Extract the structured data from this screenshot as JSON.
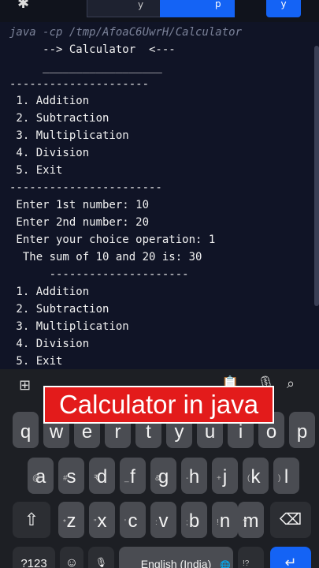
{
  "toolbar": {
    "settings_icon": "sun-gear-icon",
    "stdin_label": "y",
    "run_label": "p",
    "extra_label": "y"
  },
  "console": {
    "command": "java -cp /tmp/AfoaC6UwrH/Calculator",
    "lines": [
      "     --> Calculator  <---",
      "     __________________",
      "---------------------",
      " 1. Addition",
      " 2. Subtraction",
      " 3. Multiplication",
      " 4. Division",
      " 5. Exit",
      "-----------------------",
      " Enter 1st number: 10",
      " Enter 2nd number: 20",
      " Enter your choice operation: 1",
      "  The sum of 10 and 20 is: 30",
      "      ---------------------",
      " 1. Addition",
      " 2. Subtraction",
      " 3. Multiplication",
      " 4. Division",
      " 5. Exit"
    ]
  },
  "banner": {
    "text": "Calculator in java"
  },
  "keyboard": {
    "row1": [
      "q",
      "w",
      "e",
      "r",
      "t",
      "y",
      "u",
      "i",
      "o",
      "p"
    ],
    "row2": [
      "a",
      "s",
      "d",
      "f",
      "g",
      "h",
      "j",
      "k",
      "l"
    ],
    "row2_hints": [
      "@",
      "#",
      "₹",
      "_",
      "&",
      "-",
      "+",
      "(",
      ")"
    ],
    "row3": [
      "z",
      "x",
      "c",
      "v",
      "b",
      "n",
      "m"
    ],
    "row3_hints": [
      "*",
      "\"",
      "'",
      ":",
      ";",
      "!",
      "?"
    ],
    "numbers_key": "?123",
    "space_label": "English (India)",
    "comma_hint": "!?"
  }
}
